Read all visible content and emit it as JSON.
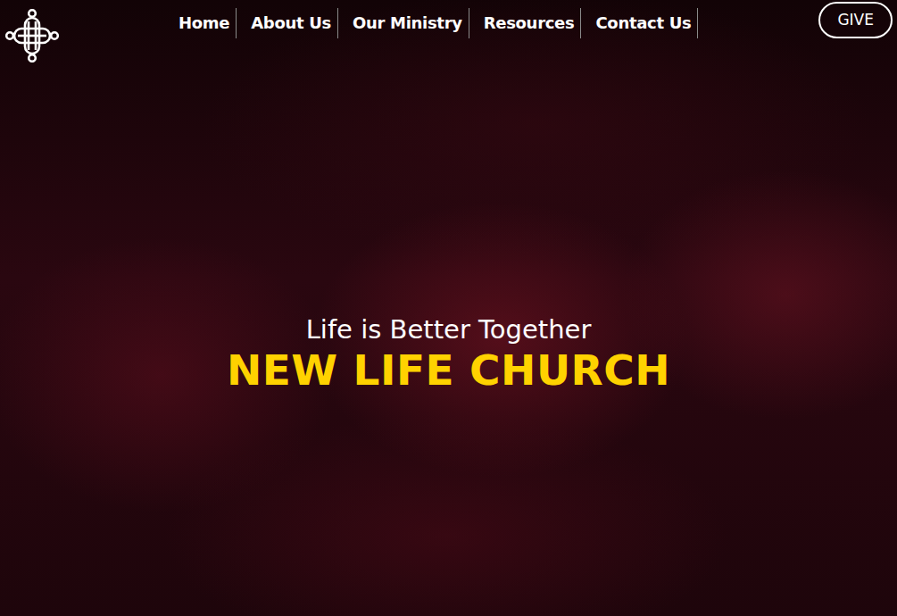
{
  "nav": {
    "items": [
      {
        "label": "Home"
      },
      {
        "label": "About Us"
      },
      {
        "label": "Our Ministry"
      },
      {
        "label": "Resources"
      },
      {
        "label": "Contact Us"
      }
    ]
  },
  "give_button": "GIVE",
  "hero": {
    "tagline": "Life is Better Together",
    "title": "NEW LIFE CHURCH"
  }
}
